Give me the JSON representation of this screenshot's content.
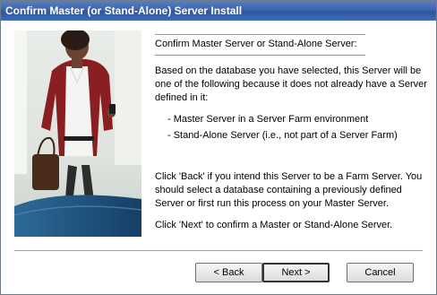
{
  "window": {
    "title": "Confirm Master (or Stand-Alone) Server Install"
  },
  "panel": {
    "header": "Confirm Master Server or Stand-Alone Server:",
    "intro": "Based on the database you have selected, this Server will be one of the following because it does not already have a Server defined in it:",
    "options": [
      "- Master Server in a Server Farm environment",
      "- Stand-Alone Server (i.e., not part of a Server Farm)"
    ],
    "back_instruction": "Click 'Back' if you intend this Server to be a Farm Server.  You should select a database containing a previously defined Server or first run this process on your Master Server.",
    "next_instruction": "Click 'Next' to confirm a Master or Stand-Alone Server."
  },
  "buttons": {
    "back": "< Back",
    "next": "Next >",
    "cancel": "Cancel"
  },
  "colors": {
    "title_bar": "#3b64ad",
    "photo_accent": "#1d4f7c"
  }
}
